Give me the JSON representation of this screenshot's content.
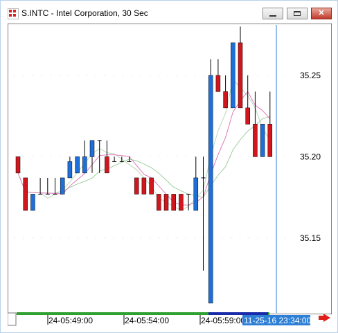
{
  "window": {
    "title": "S.INTC - Intel Corporation, 30 Sec",
    "icon": "app-chart-icon",
    "controls": [
      {
        "name": "minimize-button",
        "icon": "minimize-icon"
      },
      {
        "name": "maximize-button",
        "icon": "maximize-icon"
      },
      {
        "name": "close-button",
        "icon": "close-icon"
      }
    ]
  },
  "chart_data": {
    "type": "candlestick",
    "title": "",
    "xlabel": "",
    "ylabel": "",
    "ylim": [
      35.104,
      35.281
    ],
    "y_ticks": [
      {
        "value": 35.15,
        "label": "35.15"
      },
      {
        "value": 35.2,
        "label": "35.20"
      },
      {
        "value": 35.25,
        "label": "35.25"
      }
    ],
    "x_ticks": [
      "24-05:49:00",
      "24-05:54:00",
      "24-05:59:00"
    ],
    "crosshair_label": "11-25-16 23:34:00",
    "up_color": "#1e6fd9",
    "down_color": "#d0171d",
    "candles": [
      {
        "o": 35.2,
        "h": 35.2,
        "l": 35.19,
        "c": 35.19
      },
      {
        "o": 35.187,
        "h": 35.187,
        "l": 35.167,
        "c": 35.167
      },
      {
        "o": 35.167,
        "h": 35.177,
        "l": 35.167,
        "c": 35.177
      },
      {
        "o": 35.177,
        "h": 35.187,
        "l": 35.177,
        "c": 35.177
      },
      {
        "o": 35.177,
        "h": 35.187,
        "l": 35.177,
        "c": 35.177
      },
      {
        "o": 35.177,
        "h": 35.187,
        "l": 35.177,
        "c": 35.177
      },
      {
        "o": 35.177,
        "h": 35.187,
        "l": 35.177,
        "c": 35.187
      },
      {
        "o": 35.187,
        "h": 35.2,
        "l": 35.187,
        "c": 35.197
      },
      {
        "o": 35.19,
        "h": 35.2,
        "l": 35.19,
        "c": 35.2
      },
      {
        "o": 35.19,
        "h": 35.21,
        "l": 35.19,
        "c": 35.2
      },
      {
        "o": 35.2,
        "h": 35.21,
        "l": 35.19,
        "c": 35.21
      },
      {
        "o": 35.21,
        "h": 35.21,
        "l": 35.19,
        "c": 35.21
      },
      {
        "o": 35.2,
        "h": 35.21,
        "l": 35.19,
        "c": 35.19
      },
      {
        "o": 35.197,
        "h": 35.2,
        "l": 35.197,
        "c": 35.197
      },
      {
        "o": 35.197,
        "h": 35.2,
        "l": 35.197,
        "c": 35.197
      },
      {
        "o": 35.197,
        "h": 35.2,
        "l": 35.197,
        "c": 35.197
      },
      {
        "o": 35.187,
        "h": 35.187,
        "l": 35.177,
        "c": 35.177
      },
      {
        "o": 35.187,
        "h": 35.187,
        "l": 35.177,
        "c": 35.177
      },
      {
        "o": 35.187,
        "h": 35.187,
        "l": 35.177,
        "c": 35.177
      },
      {
        "o": 35.177,
        "h": 35.177,
        "l": 35.167,
        "c": 35.167
      },
      {
        "o": 35.177,
        "h": 35.177,
        "l": 35.167,
        "c": 35.167
      },
      {
        "o": 35.177,
        "h": 35.177,
        "l": 35.167,
        "c": 35.167
      },
      {
        "o": 35.177,
        "h": 35.177,
        "l": 35.167,
        "c": 35.167
      },
      {
        "o": 35.177,
        "h": 35.177,
        "l": 35.167,
        "c": 35.177
      },
      {
        "o": 35.167,
        "h": 35.2,
        "l": 35.167,
        "c": 35.187
      },
      {
        "o": 35.187,
        "h": 35.2,
        "l": 35.13,
        "c": 35.187
      },
      {
        "o": 35.11,
        "h": 35.26,
        "l": 35.11,
        "c": 35.25
      },
      {
        "o": 35.25,
        "h": 35.26,
        "l": 35.24,
        "c": 35.24
      },
      {
        "o": 35.24,
        "h": 35.25,
        "l": 35.23,
        "c": 35.23
      },
      {
        "o": 35.23,
        "h": 35.27,
        "l": 35.23,
        "c": 35.27
      },
      {
        "o": 35.27,
        "h": 35.28,
        "l": 35.23,
        "c": 35.23
      },
      {
        "o": 35.23,
        "h": 35.25,
        "l": 35.22,
        "c": 35.22
      },
      {
        "o": 35.22,
        "h": 35.24,
        "l": 35.2,
        "c": 35.2
      },
      {
        "o": 35.2,
        "h": 35.22,
        "l": 35.2,
        "c": 35.22
      },
      {
        "o": 35.22,
        "h": 35.24,
        "l": 35.2,
        "c": 35.2
      }
    ]
  },
  "navigator": {
    "scroll_arrow": "arrow-right-icon"
  }
}
